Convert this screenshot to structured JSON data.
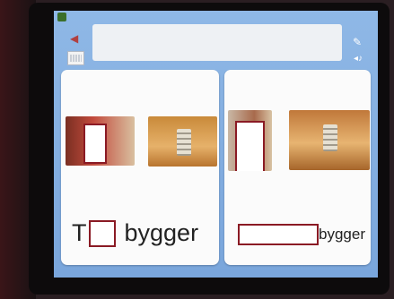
{
  "toolbar": {
    "speaker_icon": "speaker-icon",
    "keyboard_icon": "keyboard-icon",
    "pencil_icon": "pencil-icon",
    "audio_icon": "audio-icon",
    "home_icon": "home-icon"
  },
  "text_area": {
    "value": ""
  },
  "cards": [
    {
      "sentence_prefix": "T",
      "sentence_suffix": "bygger",
      "images": [
        "person-photo",
        "tower-photo"
      ]
    },
    {
      "sentence_prefix": "",
      "sentence_suffix": "bygger",
      "images": [
        "person-photo",
        "tower-photo"
      ]
    }
  ],
  "colors": {
    "screen_bg": "#8fb8e6",
    "card_bg": "#fbfbfb",
    "redaction_border": "#8a1a24"
  }
}
